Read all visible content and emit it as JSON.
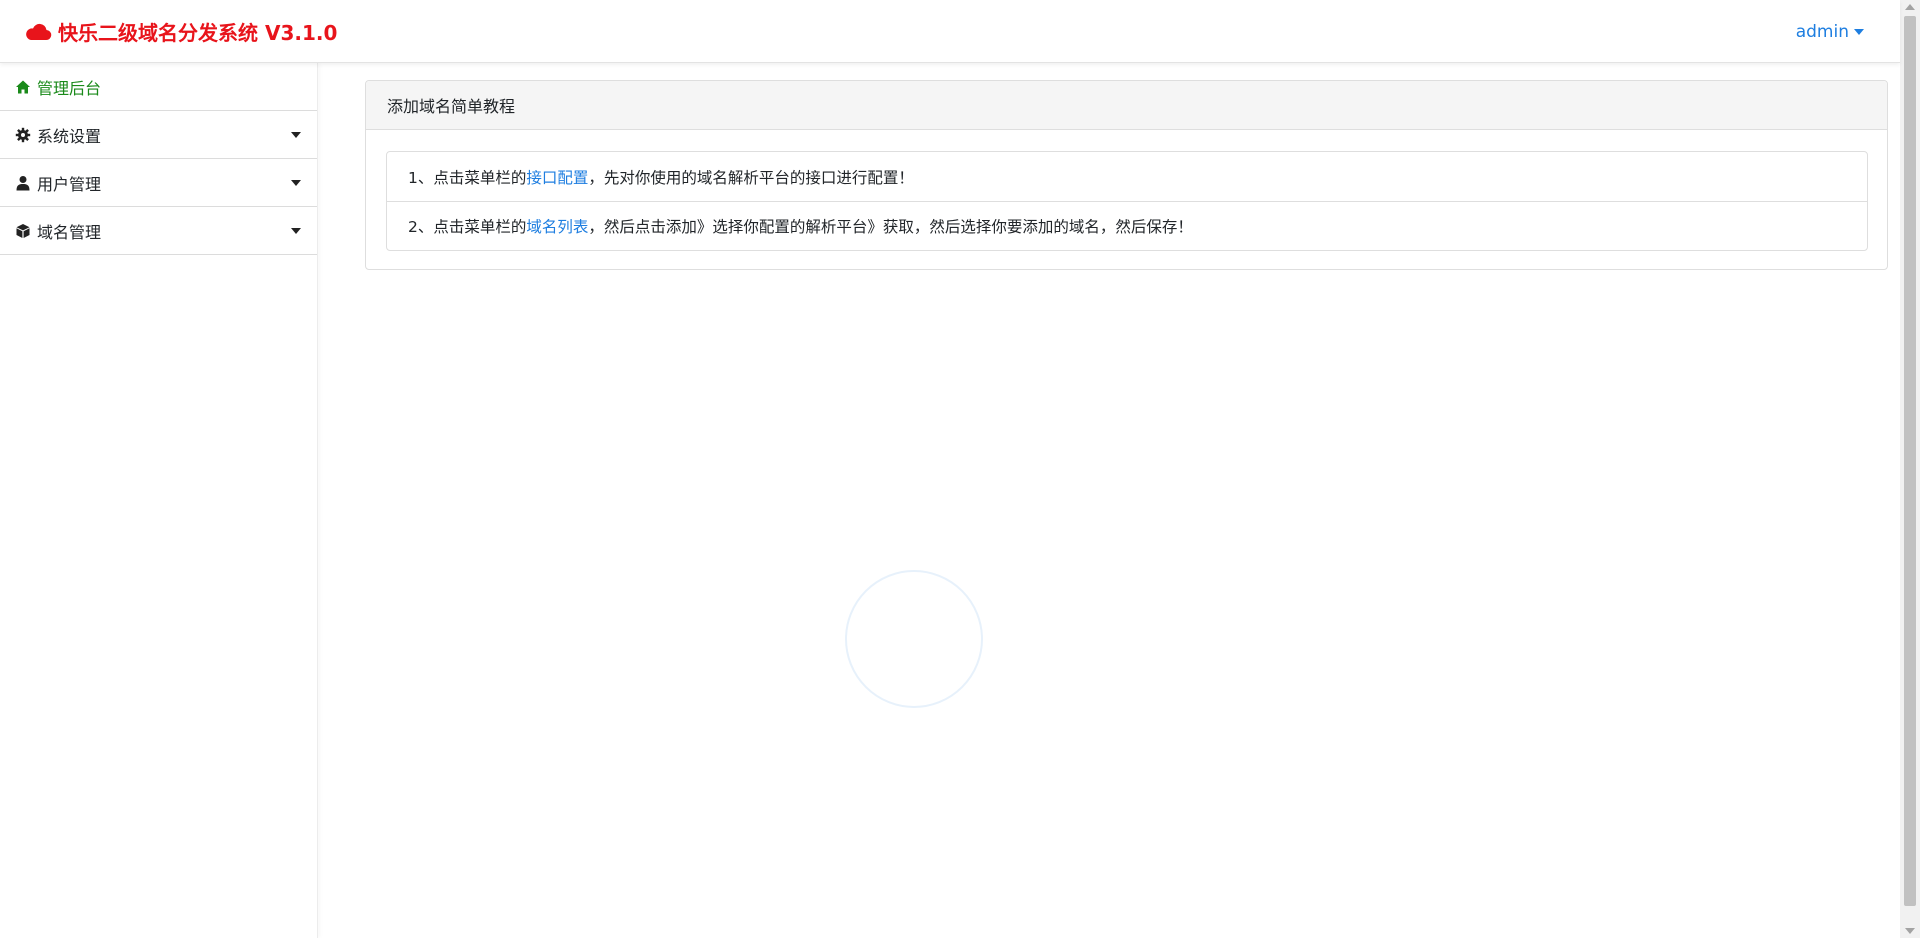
{
  "brand": {
    "title": "快乐二级域名分发系统 V3.1.0",
    "color": "#e8141b"
  },
  "user_menu": {
    "label": "admin"
  },
  "sidebar": {
    "items": [
      {
        "label": "管理后台",
        "icon": "home-icon",
        "active": true
      },
      {
        "label": "系统设置",
        "icon": "gear-icon"
      },
      {
        "label": "用户管理",
        "icon": "user-icon"
      },
      {
        "label": "域名管理",
        "icon": "cube-icon"
      }
    ]
  },
  "card": {
    "title": "添加域名简单教程",
    "steps": [
      {
        "prefix": "1、点击菜单栏的",
        "link": "接口配置",
        "suffix": "，先对你使用的域名解析平台的接口进行配置！"
      },
      {
        "prefix": "2、点击菜单栏的",
        "link": "域名列表",
        "suffix": "，然后点击添加》选择你配置的解析平台》获取，然后选择你要添加的域名，然后保存！"
      }
    ]
  },
  "colors": {
    "link": "#1e7ee0",
    "active_nav": "#1a8a1a"
  }
}
